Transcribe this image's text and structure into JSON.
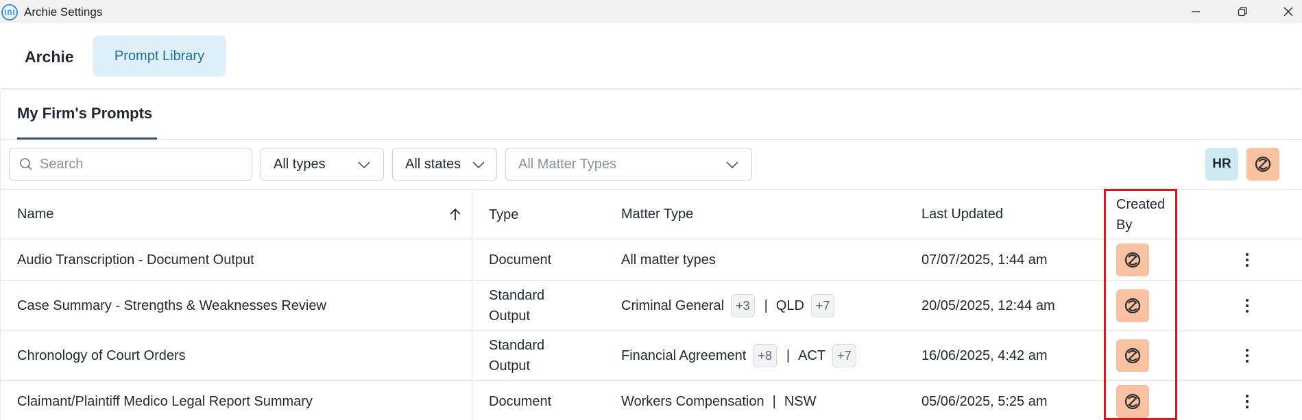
{
  "window": {
    "title": "Archie Settings",
    "icon_name": "archie-app-icon",
    "controls": [
      "minimize-icon",
      "maximize-icon",
      "close-icon"
    ]
  },
  "nav": {
    "brand": "Archie",
    "active_tab": "Prompt Library"
  },
  "subtabs": {
    "active": "My Firm's Prompts"
  },
  "filters": {
    "search_placeholder": "Search",
    "type_select": "All types",
    "state_select": "All states",
    "matter_select_placeholder": "All Matter Types",
    "user_avatar_initials": "HR",
    "user_avatar_color": "#cde9f2",
    "creator_avatar_color": "#f8c2a2"
  },
  "table": {
    "columns": {
      "name": "Name",
      "type": "Type",
      "matter_type": "Matter Type",
      "last_updated": "Last Updated",
      "created_by_line1": "Created",
      "created_by_line2": "By"
    },
    "sort": {
      "column": "Name",
      "direction": "ascending"
    },
    "rows": [
      {
        "name": "Audio Transcription - Document Output",
        "type_line1": "Document",
        "type_line2": "",
        "matter": "All matter types",
        "matter_badge": "",
        "state": "",
        "state_badge": "",
        "last_updated": "07/07/2025, 1:44 am"
      },
      {
        "name": "Case Summary - Strengths & Weaknesses Review",
        "type_line1": "Standard",
        "type_line2": "Output",
        "matter": "Criminal General",
        "matter_badge": "+3",
        "state": "QLD",
        "state_badge": "+7",
        "last_updated": "20/05/2025, 12:44 am"
      },
      {
        "name": "Chronology of Court Orders",
        "type_line1": "Standard",
        "type_line2": "Output",
        "matter": "Financial Agreement",
        "matter_badge": "+8",
        "state": "ACT",
        "state_badge": "+7",
        "last_updated": "16/06/2025, 4:42 am"
      },
      {
        "name": "Claimant/Plaintiff Medico Legal Report Summary",
        "type_line1": "Document",
        "type_line2": "",
        "matter": "Workers Compensation",
        "matter_badge": "",
        "state": "NSW",
        "state_badge": "",
        "last_updated": "05/06/2025, 5:25 am"
      }
    ],
    "separator": "|"
  },
  "annotation": {
    "highlight_color": "#e0161d"
  }
}
